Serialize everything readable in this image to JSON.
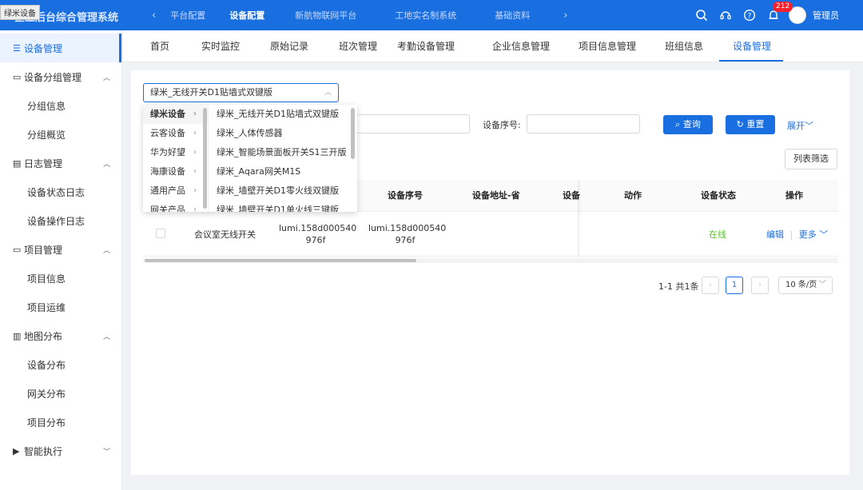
{
  "tooltip": "绿米设备",
  "app": {
    "title": "企业后台综合管理系统"
  },
  "topnav": {
    "items": [
      "平台配置",
      "设备配置",
      "新航物联网平台",
      "工地实名制系统",
      "基础资料"
    ],
    "notification_count": "212",
    "username": "管理员"
  },
  "sidebar": {
    "active": "设备管理",
    "groups": [
      {
        "label": "设备分组管理",
        "children": [
          "分组信息",
          "分组概览"
        ]
      },
      {
        "label": "日志管理",
        "children": [
          "设备状态日志",
          "设备操作日志"
        ]
      },
      {
        "label": "项目管理",
        "children": [
          "项目信息",
          "项目运维"
        ]
      },
      {
        "label": "地图分布",
        "children": [
          "设备分布",
          "网关分布",
          "项目分布"
        ]
      },
      {
        "label": "智能执行",
        "children": []
      }
    ]
  },
  "tabs": [
    "首页",
    "实时监控",
    "原始记录",
    "班次管理",
    "考勤设备管理",
    "企业信息管理",
    "项目信息管理",
    "班组信息",
    "设备管理"
  ],
  "filters": {
    "device_type_value": "绿米_无线开关D1贴墙式双键版",
    "serial_label": "设备序号:",
    "query_label": "查询",
    "reset_label": "重置",
    "expand_label": "展开"
  },
  "cascader": {
    "col1": [
      "绿米设备",
      "云客设备",
      "华为好望",
      "海康设备",
      "通用产品",
      "网关产品"
    ],
    "col2": [
      "绿米_无线开关D1贴墙式双键版",
      "绿米_人体传感器",
      "绿米_智能场景面板开关S1三开版",
      "绿米_Aqara网关M1S",
      "绿米_墙壁开关D1零火线双键版",
      "绿米_墙壁开关D1单火线三键版"
    ]
  },
  "table": {
    "column_filter_label": "列表筛选",
    "headers": [
      "设备序号",
      "设备地址-省",
      "设备",
      "动作",
      "设备状态",
      "操作"
    ],
    "row": {
      "name": "会议室无线开关",
      "id1_line1": "lumi.158d000540",
      "id1_line2": "976f",
      "id2_line1": "lumi.158d000540",
      "id2_line2": "976f",
      "status": "在线",
      "edit": "编辑",
      "sep": "|",
      "more": "更多"
    }
  },
  "pagination": {
    "summary": "1-1 共1条",
    "page": "1",
    "page_size": "10 条/页"
  },
  "colors": {
    "primary": "#1a6fe0",
    "online": "#52c41a"
  }
}
